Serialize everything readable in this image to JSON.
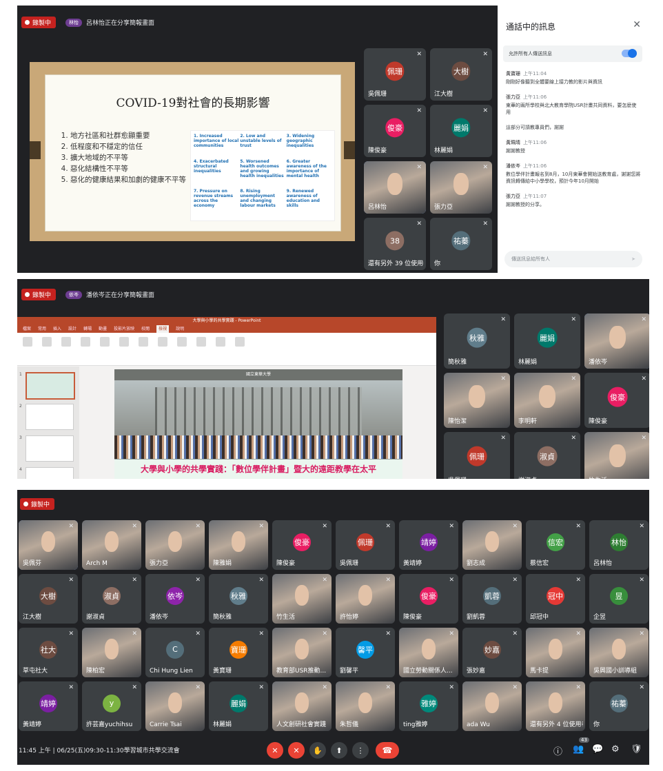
{
  "colors": {
    "recording": "#c5221f",
    "meet_bg": "#202124",
    "tile": "#3c4043",
    "accent": "#8ab4f8",
    "hangup": "#ea4335",
    "ppt": "#b7472a"
  },
  "recording_label": "錄製中",
  "panel1": {
    "presenting": {
      "pill": "林怡",
      "text": "呂林怡正在分享簡報畫面"
    },
    "slide": {
      "title": "COVID-19對社會的長期影響",
      "items": [
        "地方社區和社群愈顯重要",
        "低程度和不穩定的信任",
        "擴大地域的不平等",
        "惡化結構性不平等",
        "惡化的健康結果和加劇的健康不平等"
      ],
      "grid": [
        "1. Increased importance of local communities",
        "2. Low and unstable levels of trust",
        "3. Widening geographic inequalities",
        "4. Exacerbated structural inequalities",
        "5. Worsened health outcomes and growing health inequalities",
        "6. Greater awareness of the importance of mental health",
        "7. Pressure on revenue streams across the economy",
        "8. Rising unemployment and changing labour markets",
        "9. Renewed awareness of education and skills"
      ]
    },
    "tiles": [
      {
        "avatar": "佩珊",
        "name": "吳佩珊",
        "color": "#c0392b"
      },
      {
        "avatar": "大樹",
        "name": "江大樹",
        "color": "#6d4c41"
      },
      {
        "avatar": "俊豪",
        "name": "陳俊豪",
        "color": "#e91e63"
      },
      {
        "avatar": "麗娟",
        "name": "林麗娟",
        "color": "#00796b"
      },
      {
        "avatar": "",
        "name": "呂林怡",
        "color": "",
        "video": true,
        "active": true
      },
      {
        "avatar": "",
        "name": "張力亞",
        "color": "",
        "video": true
      },
      {
        "avatar": "38",
        "name": "還有另外 39 位使用者",
        "color": "#8d6e63"
      },
      {
        "avatar": "祐蓁",
        "name": "你",
        "color": "#546e7a"
      }
    ],
    "chat": {
      "title": "通話中的訊息",
      "close": "✕",
      "allow": "允許所有人傳送訊息",
      "messages": [
        {
          "who": "黃寶珊",
          "time": "上午11:04",
          "text": "剛剛好像聽到全體要線上接力教的影片與資訊"
        },
        {
          "who": "張力亞",
          "time": "上午11:06",
          "text": "東華的兩所學校與北大教育學院USR計畫共同資料，要怎麼使用"
        },
        {
          "who": "",
          "time": "",
          "text": "這部分可請教專員們，謝謝"
        },
        {
          "who": "黃珮晴",
          "time": "上午11:06",
          "text": "謝謝教授"
        },
        {
          "who": "潘依岑",
          "time": "上午11:06",
          "text": "數位學伴計畫報名到8月，10月東華會開始送教育處，謝謝您將資訊轉傳給中小學學校，預計今年10月開始"
        },
        {
          "who": "張力亞",
          "time": "上午11:07",
          "text": "謝謝教授的分享。"
        }
      ],
      "send_placeholder": "傳送訊息給所有人",
      "send_icon": "➤"
    }
  },
  "panel2": {
    "presenting": {
      "pill": "依岑",
      "text": "潘依岑正在分享簡報畫面"
    },
    "ppt": {
      "window_title": "大學與小學的共學實踐 - PowerPoint",
      "tabs": [
        "檔案",
        "常用",
        "插入",
        "設計",
        "轉場",
        "動畫",
        "投影片放映",
        "校閱",
        "檢視",
        "說明"
      ],
      "active_tab": "檢視",
      "slide_header": "國立東華大學",
      "caption": "大學與小學的共學實踐：「數位學伴計畫」暨大的遠距教學在太平",
      "thumb_numbers": [
        "1",
        "2",
        "3",
        "4"
      ]
    },
    "tiles": [
      {
        "avatar": "秋雅",
        "name": "簡秋雅",
        "color": "#607d8b"
      },
      {
        "avatar": "麗娟",
        "name": "林麗娟",
        "color": "#00796b"
      },
      {
        "avatar": "",
        "name": "潘依岑",
        "video": true,
        "active": true
      },
      {
        "avatar": "",
        "name": "陳怡潔",
        "video": true
      },
      {
        "avatar": "",
        "name": "李明軒",
        "video": true
      },
      {
        "avatar": "俊豪",
        "name": "陳俊豪",
        "color": "#e91e63"
      },
      {
        "avatar": "佩珊",
        "name": "吳佩珊",
        "color": "#c0392b"
      },
      {
        "avatar": "淑貞",
        "name": "謝淑貞",
        "color": "#8d6e63"
      },
      {
        "avatar": "",
        "name": "竹生活",
        "video": true
      }
    ]
  },
  "panel3": {
    "tiles": [
      {
        "avatar": "",
        "name": "吳佩芬",
        "video": true,
        "active": true
      },
      {
        "avatar": "",
        "name": "Arch M",
        "video": true
      },
      {
        "avatar": "",
        "name": "張力亞",
        "video": true
      },
      {
        "avatar": "",
        "name": "陳雅娟",
        "video": true
      },
      {
        "avatar": "俊豪",
        "name": "陳俊豪",
        "color": "#e91e63"
      },
      {
        "avatar": "佩珊",
        "name": "吳佩珊",
        "color": "#c0392b"
      },
      {
        "avatar": "靖婷",
        "name": "黃靖婷",
        "color": "#7b1fa2"
      },
      {
        "avatar": "",
        "name": "劉志成",
        "video": true
      },
      {
        "avatar": "信宏",
        "name": "蔡信宏",
        "color": "#43a047"
      },
      {
        "avatar": "林怡",
        "name": "呂林怡",
        "color": "#2e7d32"
      },
      {
        "avatar": "大樹",
        "name": "江大樹",
        "color": "#6d4c41"
      },
      {
        "avatar": "淑貞",
        "name": "謝淑貞",
        "color": "#8d6e63"
      },
      {
        "avatar": "依岑",
        "name": "潘依岑",
        "color": "#8e24aa"
      },
      {
        "avatar": "秋雅",
        "name": "簡秋雅",
        "color": "#607d8b"
      },
      {
        "avatar": "",
        "name": "竹生活",
        "video": true
      },
      {
        "avatar": "",
        "name": "許怡婷",
        "video": true
      },
      {
        "avatar": "俊豪",
        "name": "陳俊豪",
        "color": "#e91e63"
      },
      {
        "avatar": "凱蓉",
        "name": "劉凱蓉",
        "color": "#546e7a"
      },
      {
        "avatar": "冠中",
        "name": "邱冠中",
        "color": "#e53935"
      },
      {
        "avatar": "昱",
        "name": "企昱",
        "color": "#388e3c"
      },
      {
        "avatar": "社大",
        "name": "草屯社大",
        "color": "#6d4c41"
      },
      {
        "avatar": "",
        "name": "陳柏宏",
        "video": true
      },
      {
        "avatar": "C",
        "name": "Chi Hung Lien",
        "color": "#546e7a"
      },
      {
        "avatar": "寶珊",
        "name": "黃寶珊",
        "color": "#f57c00"
      },
      {
        "avatar": "",
        "name": "教育部USR推動...",
        "video": true
      },
      {
        "avatar": "馨平",
        "name": "劉馨平",
        "color": "#039be5"
      },
      {
        "avatar": "",
        "name": "國立勞動關係人...",
        "video": true
      },
      {
        "avatar": "妙嘉",
        "name": "張妙嘉",
        "color": "#6d4c41"
      },
      {
        "avatar": "",
        "name": "馬卡提",
        "video": true
      },
      {
        "avatar": "",
        "name": "吳興國小訓導組",
        "video": true
      },
      {
        "avatar": "靖婷",
        "name": "黃靖婷",
        "color": "#7b1fa2"
      },
      {
        "avatar": "y",
        "name": "許芸嘉yuchihsu",
        "color": "#7cb342"
      },
      {
        "avatar": "",
        "name": "Carrie Tsai",
        "video": true
      },
      {
        "avatar": "麗娟",
        "name": "林麗娟",
        "color": "#00796b"
      },
      {
        "avatar": "",
        "name": "人文創研社會實踐",
        "video": true
      },
      {
        "avatar": "",
        "name": "朱哲儀",
        "video": true
      },
      {
        "avatar": "雅婷",
        "name": "ting雅婷",
        "color": "#00897b"
      },
      {
        "avatar": "",
        "name": "ada Wu",
        "video": true
      },
      {
        "avatar": "",
        "name": "還有另外 4 位使用者",
        "video": true
      },
      {
        "avatar": "祐蓁",
        "name": "你",
        "color": "#546e7a"
      }
    ],
    "bottom": {
      "meeting_info": "11:45 上午 | 06/25(五)09:30-11:30學習城市共學交流會",
      "people_count": "43",
      "buttons": {
        "mic": "✕",
        "cam": "✕",
        "hand": "✋",
        "present": "⬆",
        "more": "⋮",
        "hangup": "☎"
      },
      "right_icons": {
        "info": "ⓘ",
        "people": "👥",
        "chat": "💬",
        "activities": "⚙",
        "lock": "🛡"
      }
    }
  }
}
